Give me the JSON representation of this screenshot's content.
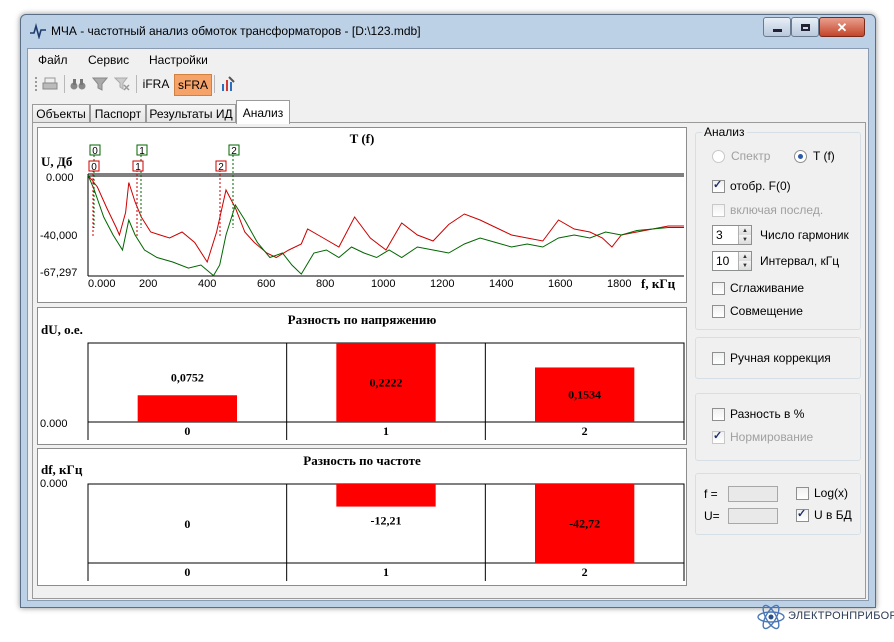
{
  "window": {
    "title": "МЧА - частотный анализ обмоток трансформаторов - [D:\\123.mdb]"
  },
  "menu": {
    "file": "Файл",
    "service": "Сервис",
    "settings": "Настройки"
  },
  "toolbar": {
    "ifra": "iFRA",
    "sfra": "sFRA",
    "sfra_color": "#f6a36a"
  },
  "tabs": [
    "Объекты",
    "Паспорт",
    "Результаты ИД",
    "Анализ"
  ],
  "chart1": {
    "title": "T (f)",
    "ylabel": "U, Дб",
    "xlabel": "f, кГц",
    "yticks": [
      "0.000",
      "-40,000",
      "-67,297"
    ],
    "xticks": [
      "0.000",
      "200",
      "400",
      "600",
      "800",
      "1000",
      "1200",
      "1400",
      "1600",
      "1800"
    ],
    "markers_top": [
      "0",
      "1",
      "2"
    ],
    "markers_bottom": [
      "0",
      "1",
      "2"
    ]
  },
  "chart2": {
    "title": "Разность по напряжению",
    "ylabel": "dU, о.е.",
    "ytick": "0.000",
    "labels": [
      "0,0752",
      "0,2222",
      "0,1534"
    ],
    "categories": [
      "0",
      "1",
      "2"
    ]
  },
  "chart3": {
    "title": "Разность по частоте",
    "ylabel": "df, кГц",
    "ytick": "0.000",
    "labels": [
      "0",
      "-12,21",
      "-42,72"
    ],
    "categories": [
      "0",
      "1",
      "2"
    ]
  },
  "chart_data": [
    {
      "type": "line",
      "title": "T (f)",
      "xlabel": "f, кГц",
      "ylabel": "U, Дб",
      "xlim": [
        0,
        1900
      ],
      "ylim": [
        -67.297,
        0
      ],
      "series": [
        {
          "color": "#cc0000",
          "x": [
            0,
            30,
            60,
            90,
            100,
            120,
            130,
            150,
            170,
            200,
            230,
            260,
            300,
            340,
            380,
            410,
            440,
            470,
            500,
            530,
            570,
            600,
            640,
            680,
            700,
            750,
            800,
            850,
            900,
            950,
            1000,
            1050,
            1100,
            1150,
            1200,
            1250,
            1300,
            1350,
            1400,
            1450,
            1500,
            1550,
            1600,
            1640,
            1670,
            1700,
            1750,
            1800,
            1850,
            1900
          ],
          "y": [
            0,
            -8,
            -22,
            -35,
            -40,
            -25,
            -5,
            -18,
            -28,
            -38,
            -40,
            -42,
            -38,
            -45,
            -58,
            -38,
            -10,
            -22,
            -38,
            -45,
            -52,
            -55,
            -50,
            -46,
            -36,
            -42,
            -48,
            -28,
            -42,
            -50,
            -32,
            -40,
            -44,
            -33,
            -26,
            -30,
            -35,
            -40,
            -42,
            -44,
            -30,
            -36,
            -38,
            -42,
            -48,
            -40,
            -38,
            -36,
            -34,
            -34
          ]
        },
        {
          "color": "#006600",
          "x": [
            0,
            20,
            50,
            80,
            110,
            130,
            150,
            180,
            220,
            270,
            320,
            360,
            400,
            420,
            440,
            470,
            500,
            540,
            580,
            620,
            650,
            680,
            720,
            760,
            800,
            840,
            880,
            920,
            960,
            1000,
            1050,
            1100,
            1150,
            1200,
            1250,
            1300,
            1350,
            1400,
            1450,
            1500,
            1550,
            1600,
            1650,
            1700,
            1750,
            1800,
            1850,
            1900
          ],
          "y": [
            0,
            -10,
            -28,
            -40,
            -50,
            -30,
            -40,
            -50,
            -55,
            -58,
            -62,
            -60,
            -67,
            -60,
            -40,
            -20,
            -30,
            -45,
            -55,
            -52,
            -60,
            -66,
            -52,
            -50,
            -55,
            -48,
            -52,
            -55,
            -50,
            -55,
            -48,
            -50,
            -52,
            -46,
            -42,
            -45,
            -48,
            -46,
            -48,
            -42,
            -40,
            -42,
            -38,
            -40,
            -37,
            -36,
            -35,
            -35
          ]
        }
      ]
    },
    {
      "type": "bar",
      "title": "Разность по напряжению",
      "ylabel": "dU, о.е.",
      "categories": [
        "0",
        "1",
        "2"
      ],
      "values": [
        0.0752,
        0.2222,
        0.1534
      ],
      "ylim": [
        0,
        0.2222
      ],
      "color": "#ff0000"
    },
    {
      "type": "bar",
      "title": "Разность по частоте",
      "ylabel": "df, кГц",
      "categories": [
        "0",
        "1",
        "2"
      ],
      "values": [
        0,
        -12.21,
        -42.72
      ],
      "ylim": [
        -42.72,
        0
      ],
      "color": "#ff0000"
    }
  ],
  "side": {
    "analysis_group": "Анализ",
    "spectrum": "Спектр",
    "tf": "T (f)",
    "show_f0": "отобр.  F(0)",
    "incl_last": "включая послед.",
    "harmonics_value": "3",
    "harmonics_label": "Число гармоник",
    "interval_value": "10",
    "interval_label": "Интервал, кГц",
    "smoothing": "Сглаживание",
    "overlay": "Совмещение",
    "manual_correction": "Ручная коррекция",
    "diff_percent": "Разность в %",
    "normalization": "Нормирование",
    "f_label": "f =",
    "u_label": "U=",
    "logx": "Log(x)",
    "u_db": "U в БД"
  },
  "brand": {
    "text": "ЭЛЕКТРОНПРИБОР"
  }
}
